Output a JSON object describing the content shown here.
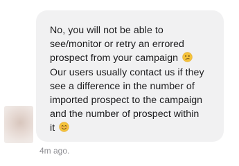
{
  "conversation": {
    "message": {
      "line_1": "No, you will not be able to",
      "line_2": "see/monitor or retry an errored",
      "line_3": "prospect from your campaign",
      "line_3_emoji": "confused-face-icon",
      "line_4": "Our users usually contact us if they",
      "line_5": "see a difference in the number of",
      "line_6": "imported prospect to the campaign",
      "line_7": "and the number of prospect within",
      "line_8": "it",
      "line_8_emoji": "smiling-face-icon"
    },
    "timestamp": "4m ago.",
    "colors": {
      "bubble_background": "#f1f1f2",
      "text": "#1c1c1e",
      "timestamp": "#8e8e93"
    }
  }
}
